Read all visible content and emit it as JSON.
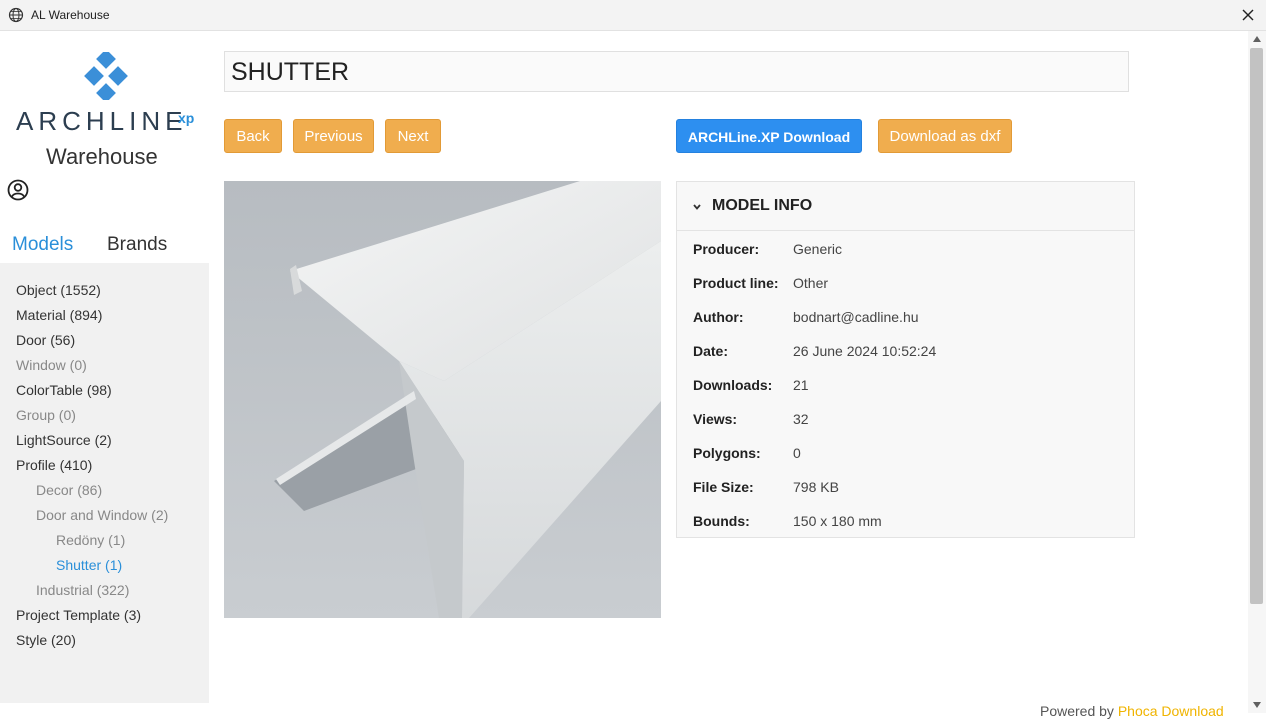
{
  "window": {
    "title": "AL Warehouse"
  },
  "logo": {
    "brand": "ARCHLINE",
    "suffix": "xp",
    "subtitle": "Warehouse"
  },
  "tabs": [
    {
      "label": "Models",
      "active": true
    },
    {
      "label": "Brands",
      "active": false
    }
  ],
  "categories": [
    {
      "label": "Object (1552)",
      "level": 0,
      "state": "normal"
    },
    {
      "label": "Material (894)",
      "level": 0,
      "state": "normal"
    },
    {
      "label": "Door (56)",
      "level": 0,
      "state": "normal"
    },
    {
      "label": "Window (0)",
      "level": 0,
      "state": "muted"
    },
    {
      "label": "ColorTable (98)",
      "level": 0,
      "state": "normal"
    },
    {
      "label": "Group (0)",
      "level": 0,
      "state": "muted"
    },
    {
      "label": "LightSource (2)",
      "level": 0,
      "state": "normal"
    },
    {
      "label": "Profile (410)",
      "level": 0,
      "state": "normal"
    },
    {
      "label": "Decor (86)",
      "level": 1,
      "state": "muted"
    },
    {
      "label": "Door and Window (2)",
      "level": 1,
      "state": "muted"
    },
    {
      "label": "Redöny (1)",
      "level": 2,
      "state": "muted"
    },
    {
      "label": "Shutter (1)",
      "level": 2,
      "state": "active"
    },
    {
      "label": "Industrial (322)",
      "level": 1,
      "state": "muted"
    },
    {
      "label": "Project Template (3)",
      "level": 0,
      "state": "normal"
    },
    {
      "label": "Style (20)",
      "level": 0,
      "state": "normal"
    }
  ],
  "model": {
    "title": "SHUTTER"
  },
  "buttons": {
    "back": "Back",
    "previous": "Previous",
    "next": "Next",
    "archline_download": "ARCHLine.XP Download",
    "download_dxf": "Download as dxf"
  },
  "info": {
    "header": "MODEL INFO",
    "rows": [
      {
        "label": "Producer:",
        "value": "Generic"
      },
      {
        "label": "Product line:",
        "value": "Other"
      },
      {
        "label": "Author:",
        "value": "bodnart@cadline.hu"
      },
      {
        "label": "Date:",
        "value": "26 June 2024 10:52:24"
      },
      {
        "label": "Downloads:",
        "value": "21"
      },
      {
        "label": "Views:",
        "value": "32"
      },
      {
        "label": "Polygons:",
        "value": "0"
      },
      {
        "label": "File Size:",
        "value": "798 KB"
      },
      {
        "label": "Bounds:",
        "value": "150 x 180 mm"
      }
    ]
  },
  "footer": {
    "prefix": "Powered by ",
    "link": "Phoca Download"
  },
  "colors": {
    "accent": "#2a8fd9",
    "orange_button": "#f0ad4e",
    "blue_button": "#2d8ff0",
    "sidebar_bg": "#f1f1f1"
  },
  "icons": {
    "window": "globe-icon",
    "close": "close-icon",
    "user": "user-circle-icon",
    "collapse": "chevron-down-icon"
  }
}
